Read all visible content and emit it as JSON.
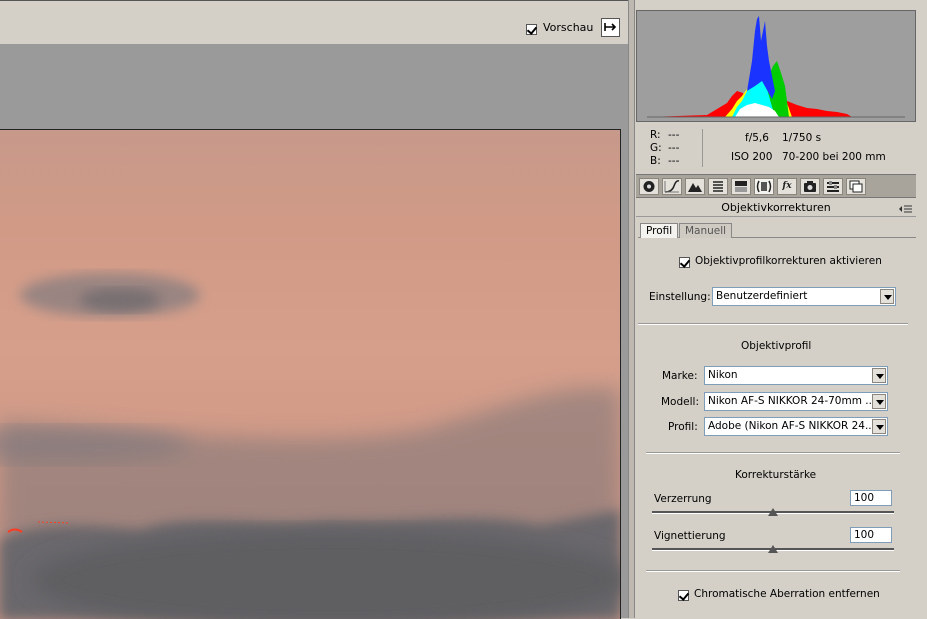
{
  "toolbar": {
    "preview_label": "Vorschau",
    "preview_checked": true,
    "toggle_icon": "panel-toggle-icon"
  },
  "histogram": {
    "shadow_clip_icon": "shadow-clipping-warning-icon",
    "highlight_clip_icon": "highlight-clipping-warning-icon",
    "highlight_clip_color": "#cc0000",
    "r_label": "R:",
    "r_value": "---",
    "g_label": "G:",
    "g_value": "---",
    "b_label": "B:",
    "b_value": "---",
    "aperture": "f/5,6",
    "shutter": "1/750 s",
    "iso": "ISO 200",
    "lens": "70-200 bei 200 mm"
  },
  "tools": [
    {
      "icon": "basic-aperture-icon"
    },
    {
      "icon": "tone-curve-icon"
    },
    {
      "icon": "detail-icon"
    },
    {
      "icon": "hsl-icon"
    },
    {
      "icon": "split-toning-icon"
    },
    {
      "icon": "lens-corrections-icon",
      "active": true
    },
    {
      "icon": "fx-icon",
      "text": "fx"
    },
    {
      "icon": "camera-calibration-icon"
    },
    {
      "icon": "presets-icon"
    },
    {
      "icon": "snapshots-icon"
    }
  ],
  "section": {
    "title": "Objektivkorrekturen",
    "menu_icon": "panel-menu-icon"
  },
  "subtabs": {
    "profile": "Profil",
    "manual": "Manuell"
  },
  "profile": {
    "enable_label": "Objektivprofilkorrekturen aktivieren",
    "enable_checked": true,
    "setting_label": "Einstellung:",
    "setting_value": "Benutzerdefiniert",
    "lens_profile_heading": "Objektivprofil",
    "make_label": "Marke:",
    "make_value": "Nikon",
    "model_label": "Modell:",
    "model_value": "Nikon AF-S NIKKOR 24-70mm ...",
    "profile_label": "Profil:",
    "profile_value": "Adobe (Nikon AF-S NIKKOR 24...",
    "strength_heading": "Korrekturstärke",
    "distortion_label": "Verzerrung",
    "distortion_value": "100",
    "vignetting_label": "Vignettierung",
    "vignetting_value": "100",
    "ca_label": "Chromatische Aberration entfernen",
    "ca_checked": true
  },
  "colors": {
    "ui_gray": "#d4d0c8",
    "sky": "#d19a87",
    "histogram_bg": "#9e9e9e"
  }
}
